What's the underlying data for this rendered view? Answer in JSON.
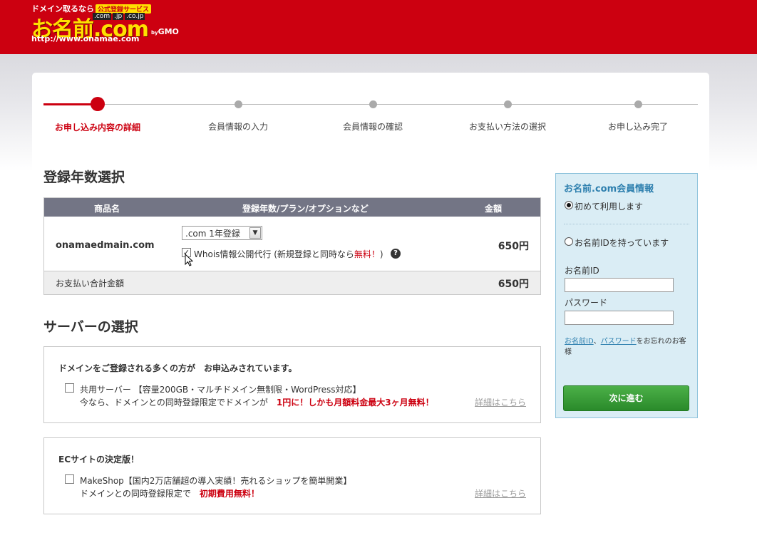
{
  "header": {
    "tagline": "ドメイン取るなら",
    "tagline_badge": "公式登録サービス",
    "subdomains": [
      ".com",
      ".jp",
      ".co.jp"
    ],
    "wordmark": "お名前.com",
    "by": "by",
    "by_brand": "GMO",
    "url": "http://www.onamae.com",
    "brand_color": "#cc0010"
  },
  "steps": [
    {
      "label": "お申し込み内容の詳細",
      "active": true
    },
    {
      "label": "会員情報の入力",
      "active": false
    },
    {
      "label": "会員情報の確認",
      "active": false
    },
    {
      "label": "お支払い方法の選択",
      "active": false
    },
    {
      "label": "お申し込み完了",
      "active": false
    }
  ],
  "registration": {
    "heading": "登録年数選択",
    "columns": {
      "product": "商品名",
      "plan": "登録年数/プラン/オプションなど",
      "amount": "金額"
    },
    "domain": "onamaedmain.com",
    "year_select": ".com 1年登録",
    "whois_label": "Whois情報公開代行 (新規登録と同時なら",
    "whois_free": "無料！",
    "whois_close": ")",
    "whois_checked": true,
    "price": "650円",
    "total_label": "お支払い合計金額",
    "total_price": "650円"
  },
  "server": {
    "heading": "サーバーの選択",
    "box1": {
      "title": "ドメインをご登録される多くの方が　お申込みされています。",
      "line1": "共用サーバー 【容量200GB・マルチドメイン無制限・WordPress対応】",
      "line2": "今なら、ドメインとの同時登録限定でドメインが",
      "highlight": "1円に！しかも月額料金最大3ヶ月無料！",
      "detail": "詳細はこちら"
    },
    "box2": {
      "title": "ECサイトの決定版！",
      "line1": "MakeShop【国内2万店舗超の導入実績！売れるショップを簡単開業】",
      "line2": "ドメインとの同時登録限定で",
      "highlight": "初期費用無料！",
      "detail": "詳細はこちら"
    }
  },
  "member": {
    "title": "お名前.com会員情報",
    "option_new": "初めて利用します",
    "option_existing": "お名前IDを持っています",
    "id_label": "お名前ID",
    "password_label": "パスワード",
    "forgot_id": "お名前ID",
    "forgot_sep": "、",
    "forgot_password": "パスワード",
    "forgot_suffix": "をお忘れのお客様",
    "next_button": "次に進む"
  }
}
